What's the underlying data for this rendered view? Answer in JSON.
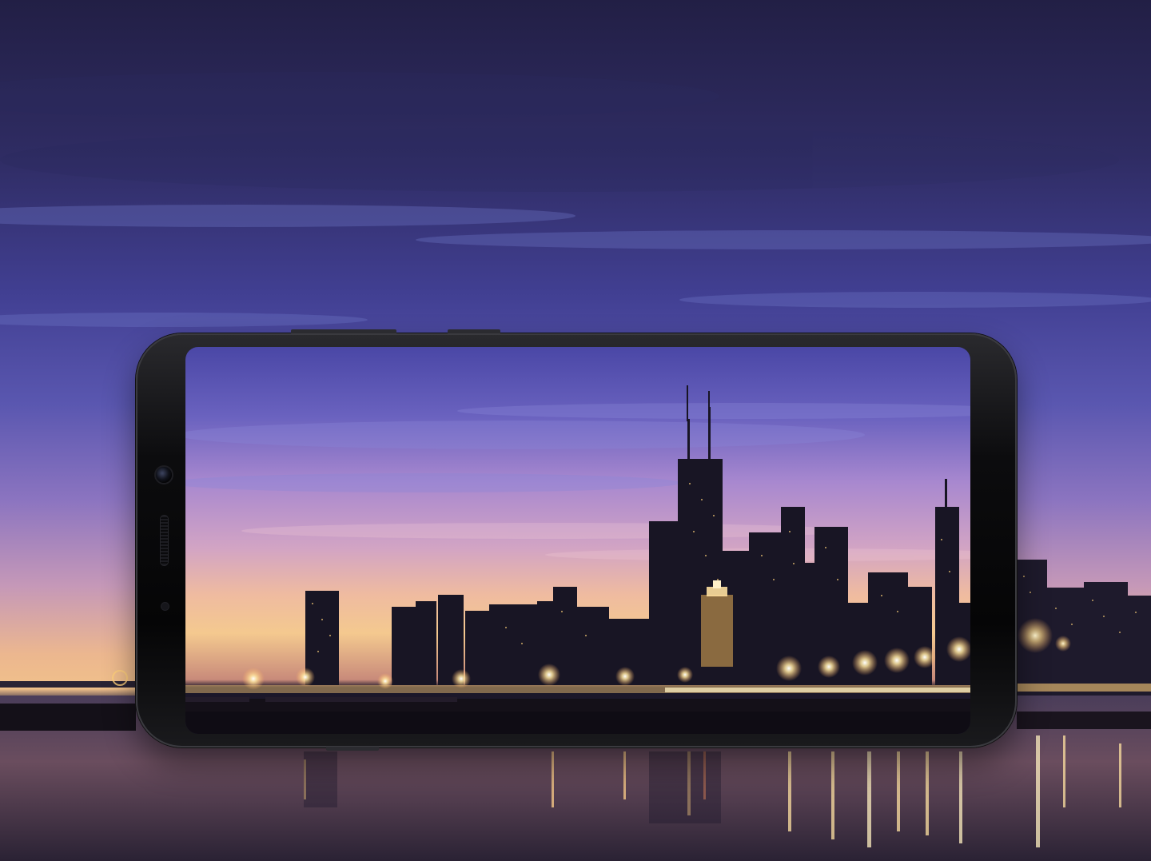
{
  "scene": {
    "subject": "smartphone-over-city-skyline",
    "colors": {
      "sky_top": "#221f45",
      "sky_mid": "#4a4aa0",
      "sky_horizon": "#f0b88a",
      "water": "#3a2f4a",
      "city_silhouette": "#1a1828",
      "light_glow": "#ffe7a8",
      "phone_body": "#0b0b0d"
    }
  }
}
